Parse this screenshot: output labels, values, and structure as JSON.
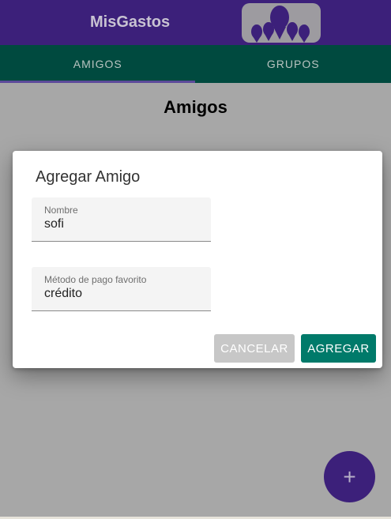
{
  "app": {
    "title": "MisGastos",
    "logo": "people-group-logo"
  },
  "tabs": [
    {
      "label": "AMIGOS",
      "selected": true
    },
    {
      "label": "GRUPOS",
      "selected": false
    }
  ],
  "page": {
    "title": "Amigos"
  },
  "dialog": {
    "title": "Agregar Amigo",
    "fields": [
      {
        "label": "Nombre",
        "value": "sofi"
      },
      {
        "label": "Método de pago favorito",
        "value": "crédito"
      }
    ],
    "cancel_label": "CANCELAR",
    "add_label": "AGREGAR"
  },
  "fab": {
    "label": "+"
  },
  "colors": {
    "primary": "#3c207a",
    "secondary": "#004a3f",
    "accent": "#007a6a"
  }
}
